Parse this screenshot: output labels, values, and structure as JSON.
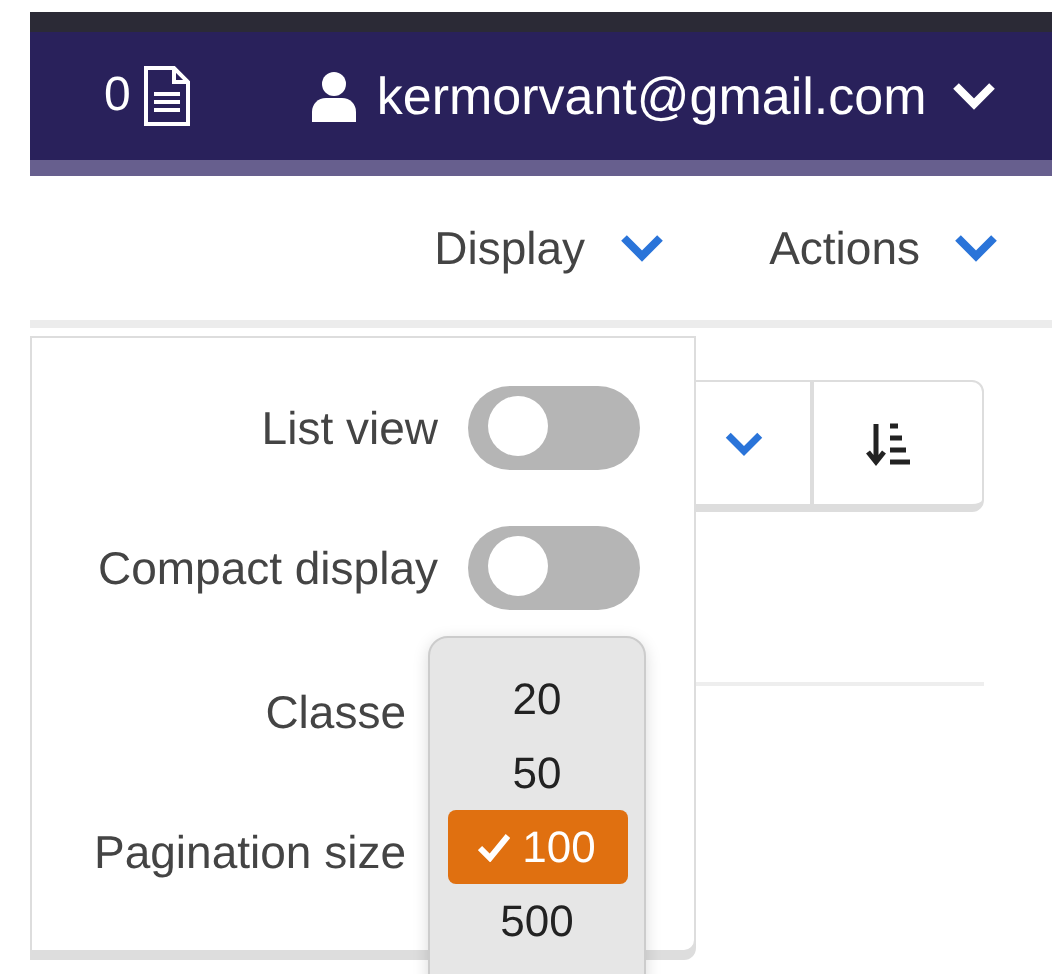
{
  "navbar": {
    "count": "0",
    "user": "kermorvant@gmail.com"
  },
  "toolbar": [
    {
      "label": "Display"
    },
    {
      "label": "Actions"
    }
  ],
  "display_menu": {
    "options": [
      {
        "kind": "toggle",
        "label": "List view",
        "on": false
      },
      {
        "kind": "toggle",
        "label": "Compact display",
        "on": false
      },
      {
        "kind": "select",
        "label": "Classe"
      },
      {
        "kind": "select",
        "label": "Pagination size"
      }
    ]
  },
  "pagination_popup": {
    "items": [
      {
        "label": "20",
        "selected": false
      },
      {
        "label": "50",
        "selected": false
      },
      {
        "label": "100",
        "selected": true
      },
      {
        "label": "500",
        "selected": false
      }
    ]
  }
}
